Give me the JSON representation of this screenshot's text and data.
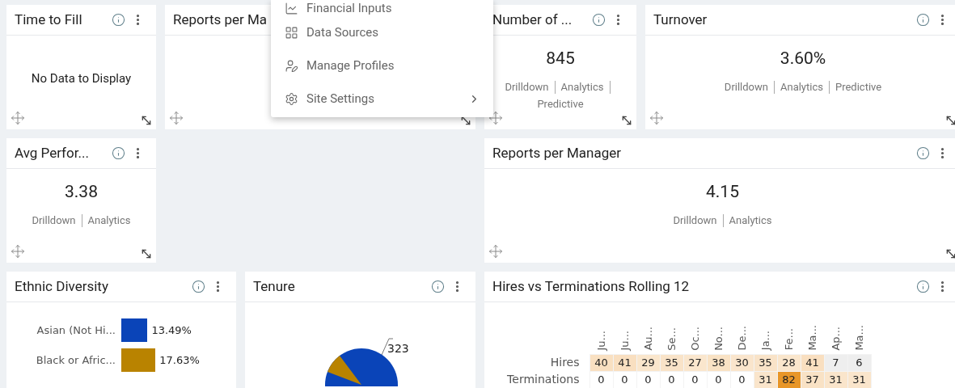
{
  "widgets": [
    {
      "kind": "empty",
      "title": "Time to Fill",
      "message": "No Data to Display"
    },
    {
      "kind": "covered",
      "title": "Reports per Ma"
    },
    {
      "kind": "metric",
      "title": "Number of ...",
      "value": "845",
      "links": [
        "Drilldown",
        "Analytics",
        "Predictive"
      ]
    },
    {
      "kind": "metric",
      "title": "Turnover",
      "value": "3.60%",
      "links": [
        "Drilldown",
        "Analytics",
        "Predictive"
      ]
    },
    {
      "kind": "metric",
      "title": "Avg Perfor...",
      "value": "3.38",
      "links": [
        "Drilldown",
        "Analytics"
      ]
    },
    {
      "kind": "metric",
      "title": "Reports per Manager",
      "value": "4.15",
      "links": [
        "Drilldown",
        "Analytics"
      ]
    },
    {
      "kind": "bar",
      "title": "Ethnic Diversity",
      "chart_data": {
        "type": "bar",
        "orientation": "horizontal",
        "categories": [
          "Asian (Not Hi...",
          "Black or Afric..."
        ],
        "values": [
          13.49,
          17.63
        ],
        "value_labels": [
          "13.49%",
          "17.63%"
        ]
      }
    },
    {
      "kind": "pie",
      "title": "Tenure",
      "label": "323"
    },
    {
      "kind": "heatmap",
      "title": "Hires vs Terminations Rolling 12",
      "months": [
        "Ju...",
        "Ju...",
        "Au...",
        "Se...",
        "Oc...",
        "No...",
        "De...",
        "Ja...",
        "Fe...",
        "Ma...",
        "Ap...",
        "Ma..."
      ],
      "rows": [
        {
          "label": "Hires",
          "values": [
            "40",
            "41",
            "29",
            "35",
            "27",
            "38",
            "30",
            "35",
            "28",
            "41",
            "7",
            "6"
          ]
        },
        {
          "label": "Terminations",
          "values": [
            "0",
            "0",
            "0",
            "0",
            "0",
            "0",
            "0",
            "31",
            "82",
            "37",
            "31",
            "31"
          ]
        }
      ]
    }
  ],
  "menu": {
    "items": [
      {
        "label": "Financial Inputs",
        "kind": "chart"
      },
      {
        "label": "Data Sources",
        "kind": "grid"
      },
      {
        "label": "Manage Profiles",
        "kind": "profile"
      },
      {
        "label": "Site Settings",
        "kind": "settings",
        "submenu": true
      }
    ]
  }
}
